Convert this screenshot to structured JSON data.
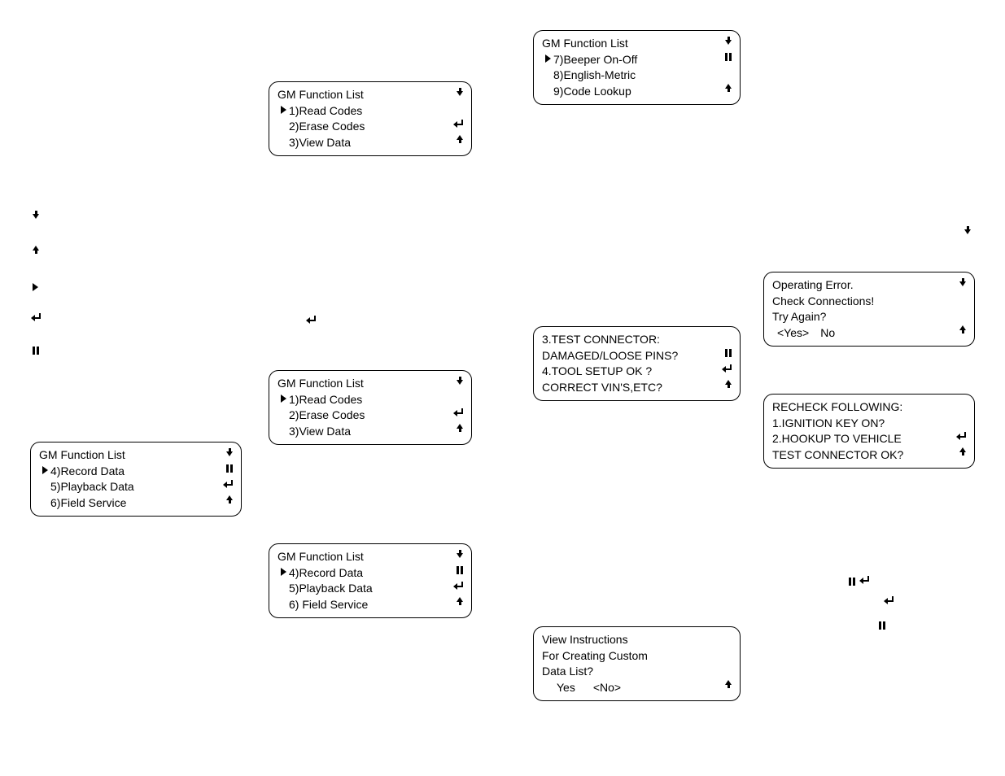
{
  "screens": {
    "list1": {
      "title": "GM Function List",
      "items": [
        {
          "label": "1)Read Codes",
          "selected": true
        },
        {
          "label": "2)Erase Codes",
          "selected": false
        },
        {
          "label": "3)View Data",
          "selected": false
        }
      ]
    },
    "list2": {
      "title": "GM Function List",
      "items": [
        {
          "label": "7)Beeper On-Off",
          "selected": true
        },
        {
          "label": "8)English-Metric",
          "selected": false
        },
        {
          "label": "9)Code Lookup",
          "selected": false
        }
      ]
    },
    "list3": {
      "title": "GM Function List",
      "items": [
        {
          "label": "1)Read Codes",
          "selected": true
        },
        {
          "label": "2)Erase Codes",
          "selected": false
        },
        {
          "label": "3)View Data",
          "selected": false
        }
      ]
    },
    "list4": {
      "title": "GM Function List",
      "items": [
        {
          "label": "4)Record Data",
          "selected": true
        },
        {
          "label": "5)Playback Data",
          "selected": false
        },
        {
          "label": "6)Field Service",
          "selected": false
        }
      ]
    },
    "list5": {
      "title": "GM Function List",
      "items": [
        {
          "label": "4)Record Data",
          "selected": true
        },
        {
          "label": "5)Playback Data",
          "selected": false
        },
        {
          "label": "6) Field Service",
          "selected": false
        }
      ]
    },
    "check1": {
      "lines": [
        "3.TEST CONNECTOR:",
        "DAMAGED/LOOSE PINS?",
        "4.TOOL SETUP OK ?",
        "CORRECT VIN'S,ETC?"
      ]
    },
    "error1": {
      "lines": [
        "Operating Error.",
        "Check Connections!",
        "Try Again?"
      ],
      "choice_yes": "<Yes>",
      "choice_no": "No"
    },
    "recheck": {
      "lines": [
        "RECHECK FOLLOWING:",
        "1.IGNITION KEY ON?",
        "2.HOOKUP TO VEHICLE",
        "TEST CONNECTOR OK?"
      ]
    },
    "view_inst": {
      "lines": [
        "View Instructions",
        "For Creating Custom",
        "Data List?"
      ],
      "choice_yes": "Yes",
      "choice_no": "<No>"
    }
  }
}
